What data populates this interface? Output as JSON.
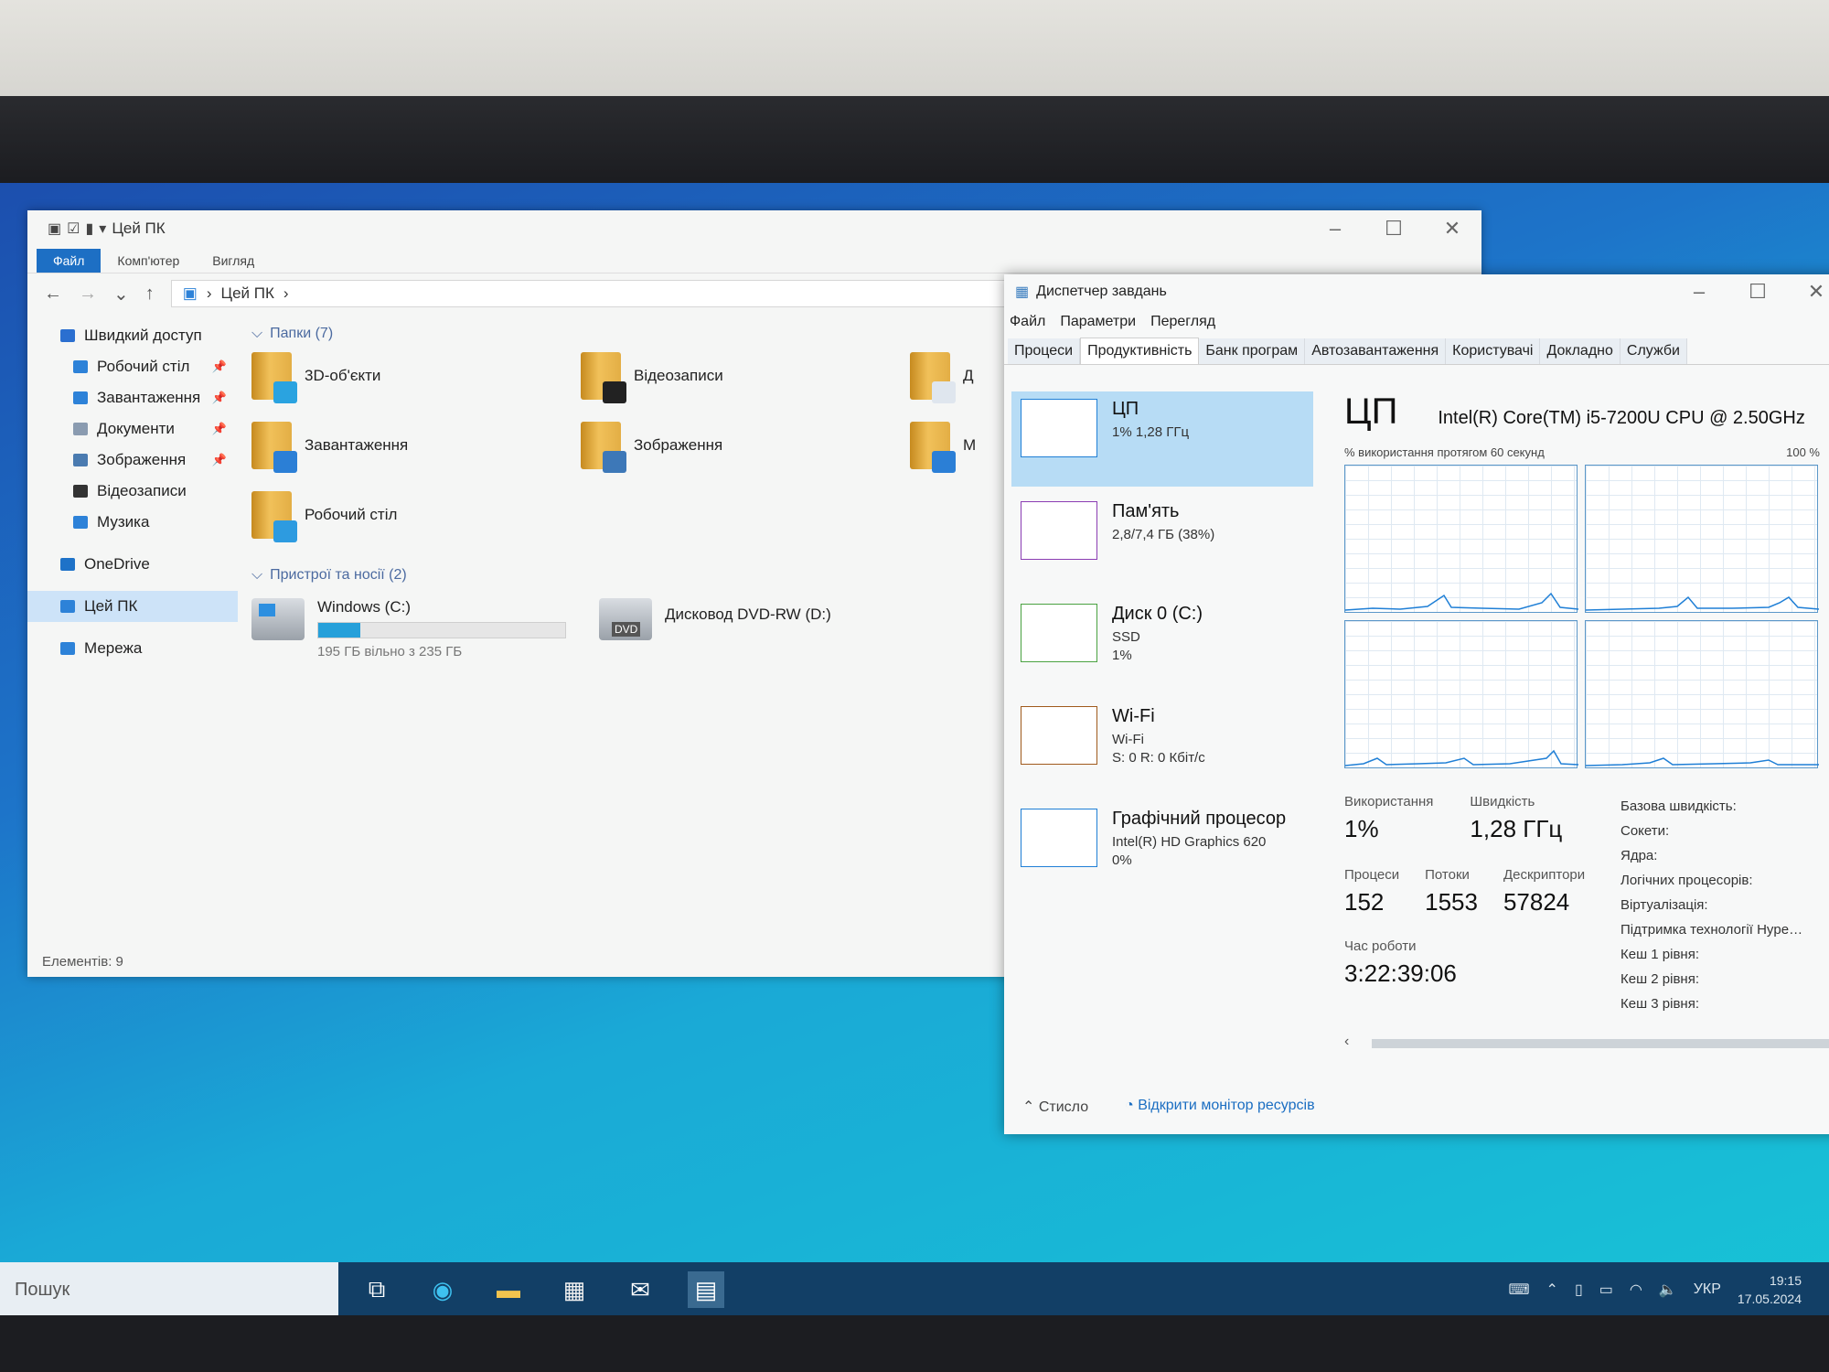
{
  "explorer": {
    "title": "Цей ПК",
    "ribbon_tabs": [
      "Файл",
      "Комп'ютер",
      "Вигляд"
    ],
    "path": "Цей ПК",
    "sidebar": [
      {
        "label": "Швидкий доступ",
        "icon": "star-icon",
        "color": "#2b6fd0"
      },
      {
        "label": "Робочий стіл",
        "icon": "desktop-icon",
        "color": "#2d82d8",
        "pinned": true
      },
      {
        "label": "Завантаження",
        "icon": "download-icon",
        "color": "#2d82d8",
        "pinned": true
      },
      {
        "label": "Документи",
        "icon": "documents-icon",
        "color": "#8a9bb0",
        "pinned": true
      },
      {
        "label": "Зображення",
        "icon": "pictures-icon",
        "color": "#4a7bb0",
        "pinned": true
      },
      {
        "label": "Відеозаписи",
        "icon": "videos-icon",
        "color": "#333"
      },
      {
        "label": "Музика",
        "icon": "music-icon",
        "color": "#2d82d8"
      },
      {
        "label": "OneDrive",
        "icon": "onedrive-icon",
        "color": "#1e72c8"
      },
      {
        "label": "Цей ПК",
        "icon": "this-pc-icon",
        "color": "#2d82d8"
      },
      {
        "label": "Мережа",
        "icon": "network-icon",
        "color": "#2d82d8"
      }
    ],
    "folders_header": "Папки (7)",
    "folders": [
      {
        "label": "3D-об'єкти",
        "overlay": "#2aa3e0"
      },
      {
        "label": "Відеозаписи",
        "overlay": "#222"
      },
      {
        "label": "Д",
        "overlay": "#dfe6ee"
      },
      {
        "label": "Завантаження",
        "overlay": "#2b7fd6"
      },
      {
        "label": "Зображення",
        "overlay": "#3d78b8"
      },
      {
        "label": "М",
        "overlay": "#2b7fd6"
      },
      {
        "label": "Робочий стіл",
        "overlay": "#2d9be0"
      }
    ],
    "devices_header": "Пристрої та носії (2)",
    "drive_c": {
      "label": "Windows (C:)",
      "free": "195 ГБ вільно з 235 ГБ",
      "used_fraction": 0.17
    },
    "drive_d": {
      "label": "Дисковод DVD-RW (D:)",
      "badge": "DVD"
    },
    "status": "Елементів: 9"
  },
  "taskmgr": {
    "title": "Диспетчер завдань",
    "menu": [
      "Файл",
      "Параметри",
      "Перегляд"
    ],
    "tabs": [
      "Процеси",
      "Продуктивність",
      "Банк програм",
      "Автозавантаження",
      "Користувачі",
      "Докладно",
      "Служби"
    ],
    "resources": [
      {
        "name": "ЦП",
        "line1": "1% 1,28 ГГц",
        "line2": "",
        "color": "#1f7fd6"
      },
      {
        "name": "Пам'ять",
        "line1": "2,8/7,4 ГБ (38%)",
        "line2": "",
        "color": "#8b3db3"
      },
      {
        "name": "Диск 0 (C:)",
        "line1": "SSD",
        "line2": "1%",
        "color": "#4aa241"
      },
      {
        "name": "Wi-Fi",
        "line1": "Wi-Fi",
        "line2": "S: 0 R: 0 Кбіт/с",
        "color": "#a05a1c"
      },
      {
        "name": "Графічний процесор",
        "line1": "Intel(R) HD Graphics 620",
        "line2": "0%",
        "color": "#1f7fd6"
      }
    ],
    "cpu_heading": "ЦП",
    "cpu_model": "Intel(R) Core(TM) i5-7200U CPU @ 2.50GHz",
    "usage_caption": "% використання протягом 60 секунд",
    "usage_max": "100 %",
    "stats": {
      "usage_label": "Використання",
      "usage": "1%",
      "speed_label": "Швидкість",
      "speed": "1,28 ГГц",
      "processes_label": "Процеси",
      "processes": "152",
      "threads_label": "Потоки",
      "threads": "1553",
      "handles_label": "Дескриптори",
      "handles": "57824",
      "uptime_label": "Час роботи",
      "uptime": "3:22:39:06"
    },
    "right_list": [
      "Базова швидкість:",
      "Сокети:",
      "Ядра:",
      "Логічних процесорів:",
      "Віртуалізація:",
      "Підтримка технології Hype…",
      "Кеш 1 рівня:",
      "Кеш 2 рівня:",
      "Кеш 3 рівня:"
    ],
    "footer_less": "Стисло",
    "footer_link": "Відкрити монітор ресурсів"
  },
  "taskbar": {
    "search": "Пошук",
    "lang": "УКР",
    "time": "19:15",
    "date": "17.05.2024"
  }
}
